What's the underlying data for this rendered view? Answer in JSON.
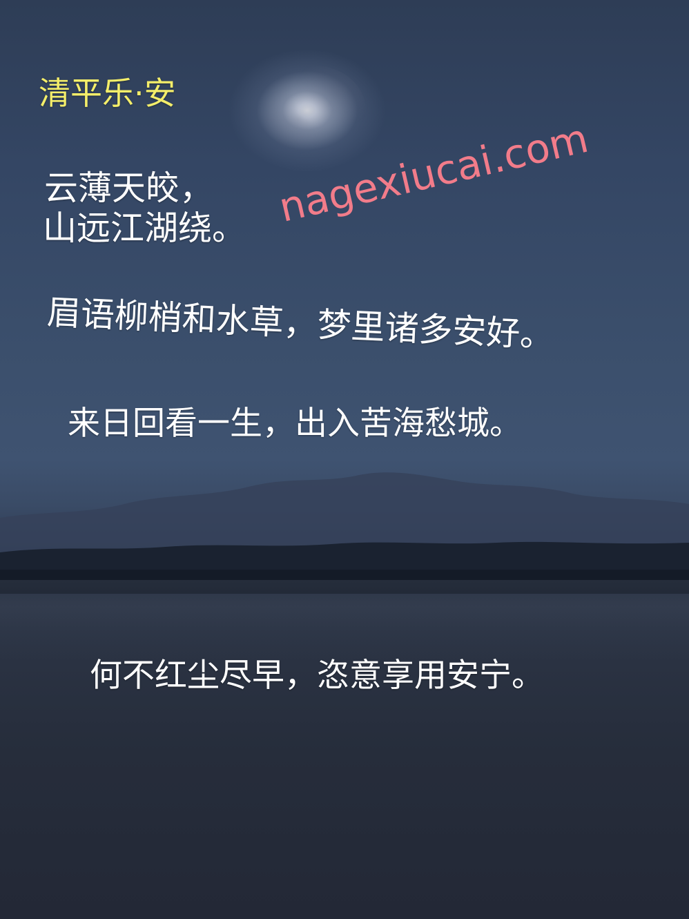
{
  "poem": {
    "title": "清平乐·安",
    "line1": "云薄天皎，",
    "line2": "山远江湖绕。",
    "line3": "眉语柳梢和水草，梦里诸多安好。",
    "line4": "来日回看一生，出入苦海愁城。",
    "line5": "何不红尘尽早，恣意享用安宁。"
  },
  "watermark": {
    "text": "nagexiucai.com"
  },
  "colors": {
    "title": "#f4ee6a",
    "text": "#ffffff",
    "watermark": "#f27c8a",
    "sky": "#3b4f6c",
    "water": "#232836"
  }
}
